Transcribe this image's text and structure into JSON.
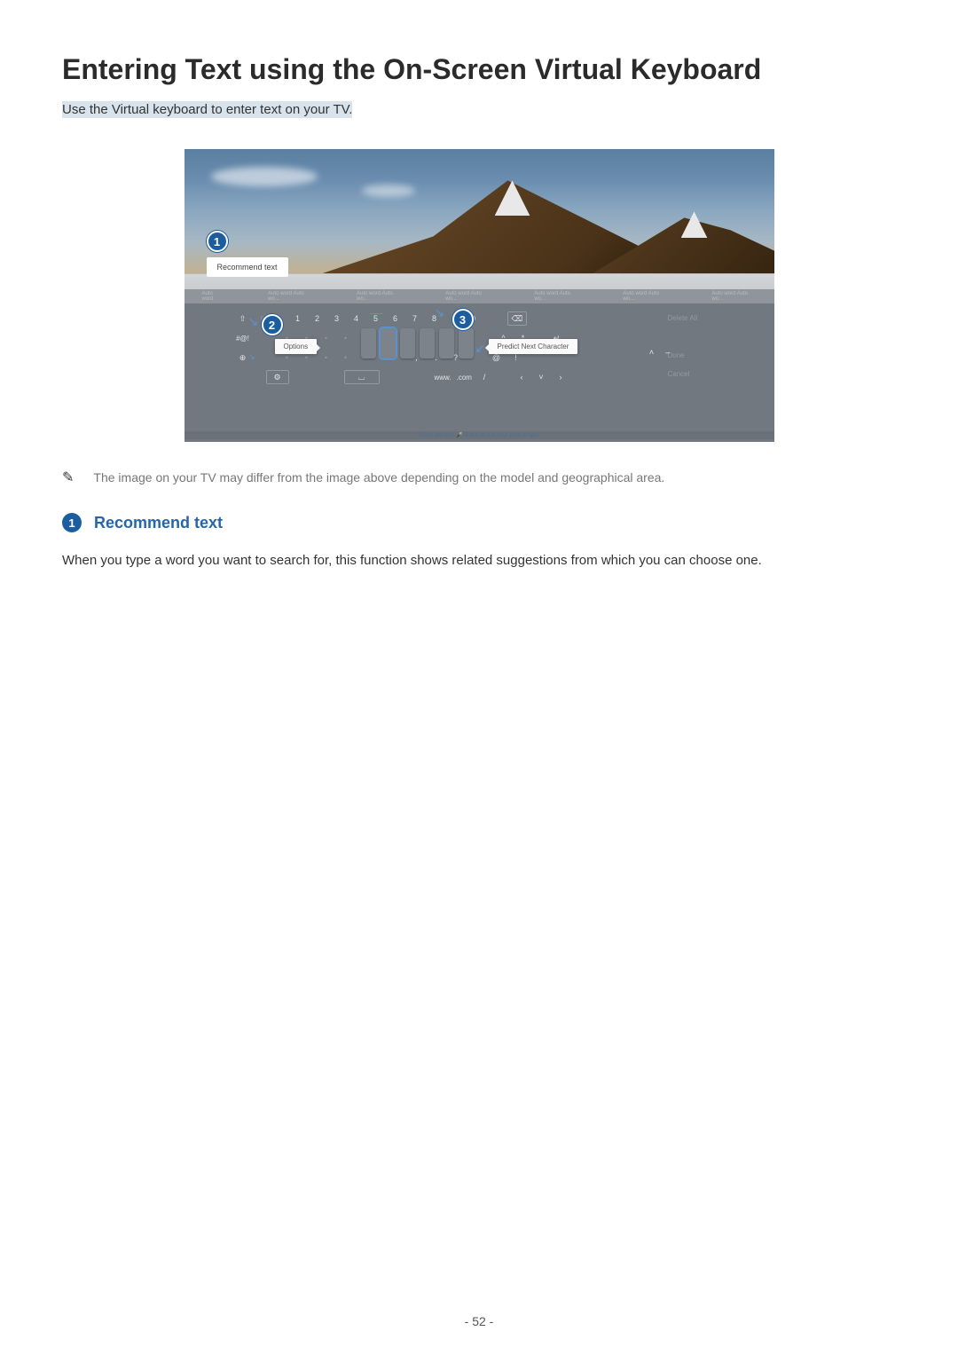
{
  "title": "Entering Text using the On-Screen Virtual Keyboard",
  "intro": "Use the Virtual keyboard to enter text on your TV.",
  "figure": {
    "annot1": "1",
    "annot2": "2",
    "annot3": "3",
    "recommend_label": "Recommend text",
    "options_tooltip": "Options",
    "predict_tooltip": "Predict Next Character",
    "sugg0": "Auto word",
    "sugg1": "Auto word Auto wo...",
    "row1": {
      "shift": "⇧",
      "n1": "1",
      "n2": "2",
      "n3": "3",
      "n4": "4",
      "n5": "5",
      "n6": "6",
      "n7": "7",
      "n8": "8",
      "n9": "9",
      "n0": "0",
      "bksp": "⌫",
      "delall": "Delete All"
    },
    "row2": {
      "sym": "#@!",
      "caret": "^",
      "star": "*",
      "enter": "↵"
    },
    "row3": {
      "globe": "⊕",
      "at": "@",
      "excl": "!",
      "done": "Done",
      "comma": ",",
      "dot": ".",
      "qmark": "?"
    },
    "row4": {
      "gear": "⚙",
      "space": "⌴",
      "www": "www.",
      "com": ".com",
      "slash": "/",
      "lt": "‹",
      "dn": "˅",
      "gt": "›",
      "cancel": "Cancel",
      "up": "˄",
      "dash": "–"
    },
    "hint": "Press and hold   🎤 Button  to use your voice to type"
  },
  "note_text": "The image on your TV may differ from the image above depending on the model and geographical area.",
  "section": {
    "num": "1",
    "title": "Recommend text",
    "body": "When you type a word you want to search for, this function shows related suggestions from which you can choose one."
  },
  "page_number": "- 52 -"
}
